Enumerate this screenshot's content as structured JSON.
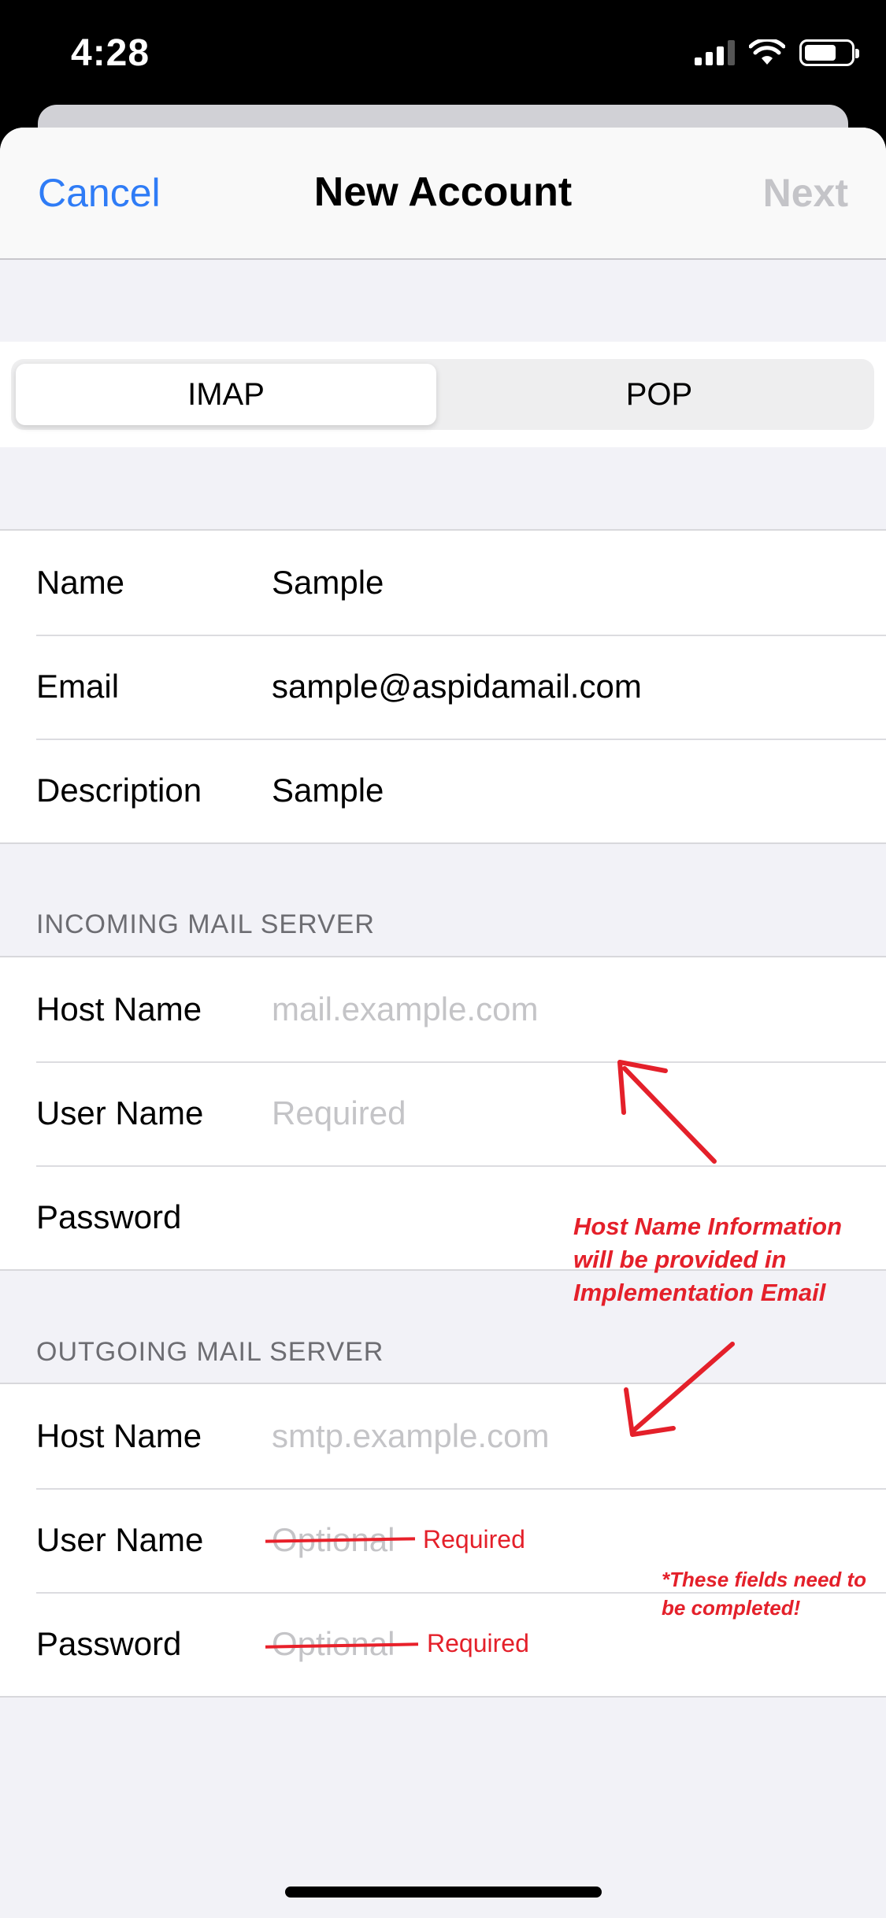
{
  "status_bar": {
    "time": "4:28"
  },
  "nav": {
    "cancel": "Cancel",
    "title": "New Account",
    "next": "Next"
  },
  "segments": {
    "imap": "IMAP",
    "pop": "POP"
  },
  "account": {
    "name_label": "Name",
    "name_value": "Sample",
    "email_label": "Email",
    "email_value": "sample@aspidamail.com",
    "description_label": "Description",
    "description_value": "Sample"
  },
  "incoming": {
    "header": "INCOMING MAIL SERVER",
    "host_label": "Host Name",
    "host_placeholder": "mail.example.com",
    "user_label": "User Name",
    "user_placeholder": "Required",
    "password_label": "Password"
  },
  "outgoing": {
    "header": "OUTGOING MAIL SERVER",
    "host_label": "Host Name",
    "host_placeholder": "smtp.example.com",
    "user_label": "User Name",
    "user_placeholder": "Optional",
    "user_note": "Required",
    "password_label": "Password",
    "password_placeholder": "Optional",
    "password_note": "Required"
  },
  "annotations": {
    "host_info": "Host Name Information will be provided in Implementation Email",
    "fields_note": "*These fields need to be completed!"
  },
  "colors": {
    "accent": "#2f7cf6",
    "annotation": "#e4202a",
    "disabled": "#c4c4c8"
  }
}
